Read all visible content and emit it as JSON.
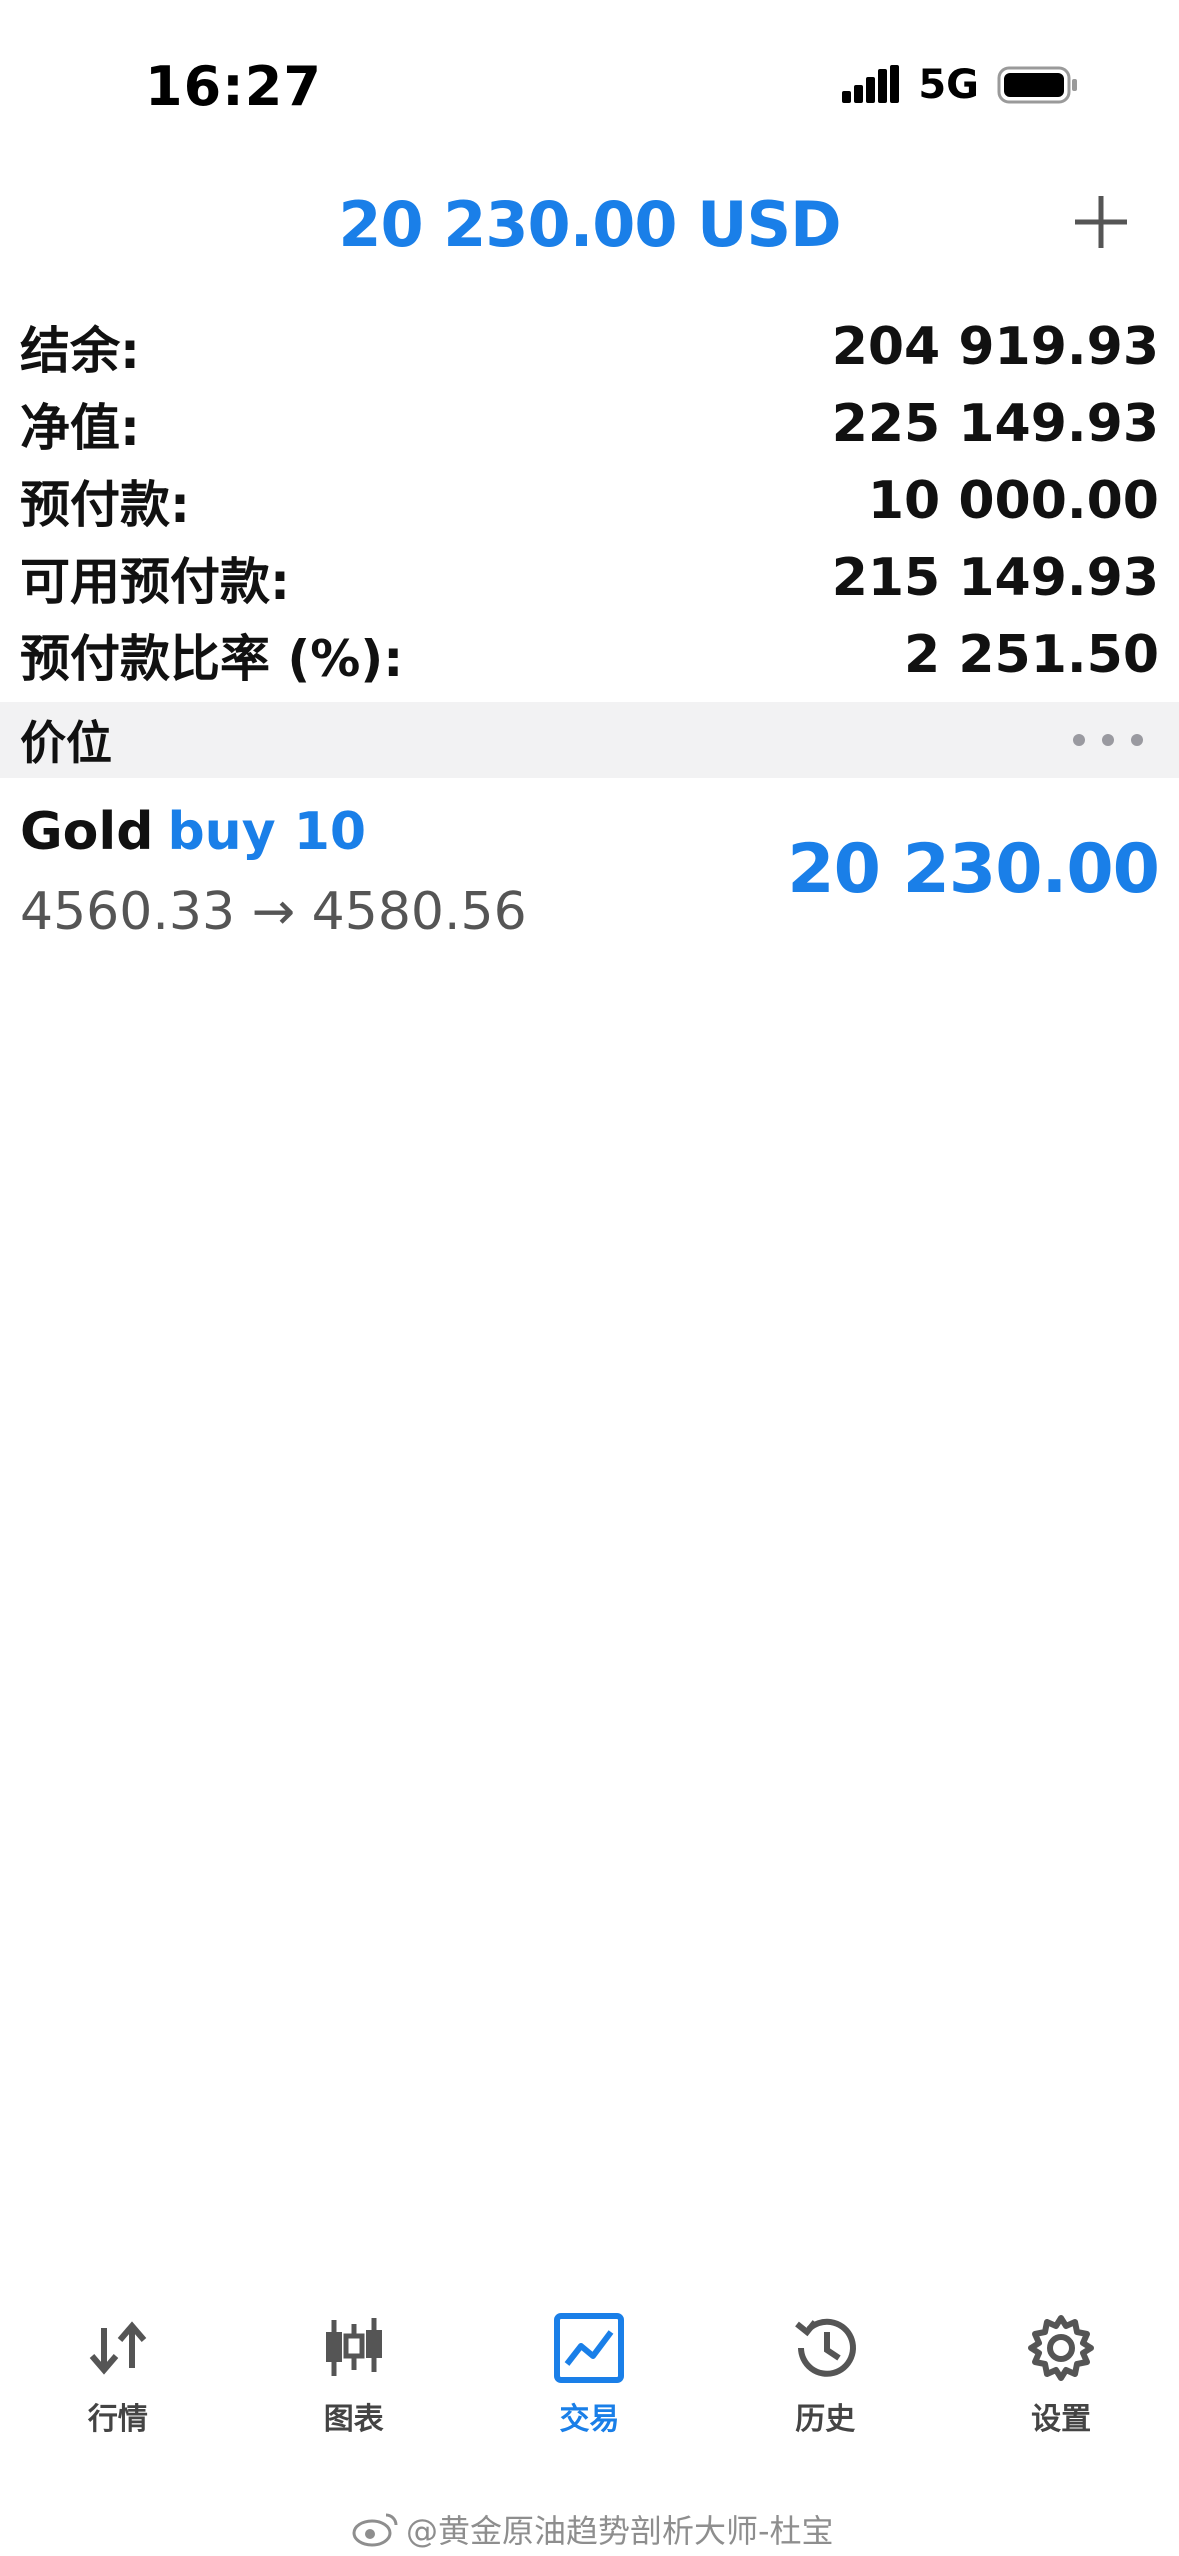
{
  "status_bar": {
    "time": "16:27",
    "network": "5G"
  },
  "header": {
    "title": "20 230.00 USD",
    "add_icon": "plus-icon"
  },
  "account": {
    "rows": [
      {
        "label": "结余:",
        "value": "204 919.93"
      },
      {
        "label": "净值:",
        "value": "225 149.93"
      },
      {
        "label": "预付款:",
        "value": "10 000.00"
      },
      {
        "label": "可用预付款:",
        "value": "215 149.93"
      },
      {
        "label": "预付款比率 (%):",
        "value": "2 251.50"
      }
    ]
  },
  "positions": {
    "section_title": "价位",
    "more_icon": "ellipsis-icon",
    "items": [
      {
        "symbol": "Gold",
        "type": "buy 10",
        "prices": "4560.33 → 4580.56",
        "profit": "20 230.00"
      }
    ]
  },
  "tabs": [
    {
      "label": "行情",
      "icon": "quotes-arrows-icon",
      "active": false
    },
    {
      "label": "图表",
      "icon": "candlestick-chart-icon",
      "active": false
    },
    {
      "label": "交易",
      "icon": "trade-chart-icon",
      "active": true
    },
    {
      "label": "历史",
      "icon": "history-clock-icon",
      "active": false
    },
    {
      "label": "设置",
      "icon": "settings-gear-icon",
      "active": false
    }
  ],
  "colors": {
    "accent": "#1a7fe8",
    "text": "#111111",
    "section_bg": "#f2f2f3"
  },
  "watermark": {
    "text": "@黄金原油趋势剖析大师-杜宝"
  }
}
